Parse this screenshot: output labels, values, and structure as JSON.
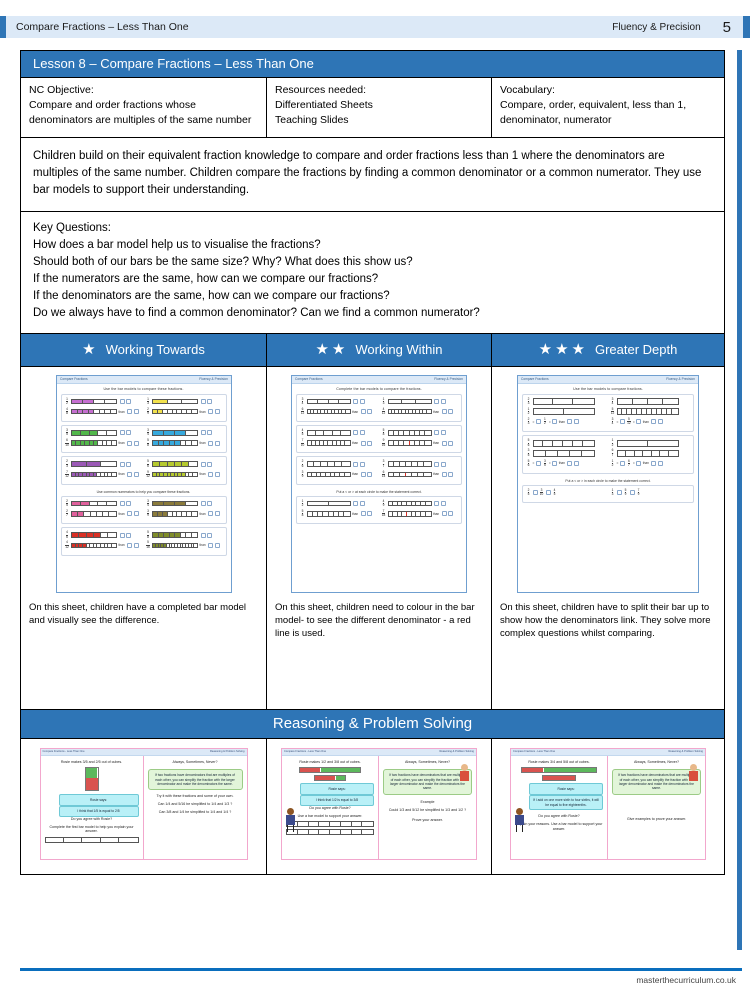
{
  "header": {
    "title": "Compare Fractions – Less Than One",
    "section": "Fluency & Precision",
    "page_number": "5",
    "accent_color": "#2E75B6",
    "background_color": "#DCE9F7"
  },
  "lesson": {
    "title": "Lesson 8 – Compare Fractions – Less Than One"
  },
  "info": {
    "objective_label": "NC Objective:",
    "objective_line1": "Compare and order fractions whose",
    "objective_line2": "denominators are multiples of the same number",
    "resources_label": "Resources needed:",
    "resources_line1": "Differentiated Sheets",
    "resources_line2": "Teaching Slides",
    "vocabulary_label": "Vocabulary:",
    "vocabulary_line1": "Compare, order, equivalent, less than 1,",
    "vocabulary_line2": "denominator, numerator"
  },
  "overview": {
    "text": "Children build on their equivalent fraction knowledge to compare and order fractions less than 1 where the denominators are multiples of the same number. Children compare the fractions by finding a common denominator or a common numerator. They use bar models to support their understanding."
  },
  "key_questions": {
    "label": "Key Questions:",
    "items": [
      "How does a bar model help us to visualise the fractions?",
      "Should both of our bars be the same size? Why? What does this show us?",
      "If the numerators are the same, how can we compare our fractions?",
      "If the denominators are the same, how can we compare our fractions?",
      "Do we always have to find a common denominator? Can we find a common numerator?"
    ]
  },
  "differentiation": {
    "columns": [
      {
        "label": "Working Towards",
        "stars": 1,
        "description": "On this sheet, children have a completed bar model and visually see the difference.",
        "sheet": {
          "header_left": "Compare Fractions",
          "header_right": "Fluency & Precision",
          "instruction": "Use the bar models to compare these fractions.",
          "sub_instruction": "Use common numerators to help you compare these fractions."
        }
      },
      {
        "label": "Working Within",
        "stars": 2,
        "description": "On this sheet, children need to colour in the bar model- to see the different denominator - a red line is used.",
        "sheet": {
          "header_left": "Compare Fractions",
          "header_right": "Fluency & Precision",
          "instruction": "Complete the bar models to compare the fractions.",
          "sub_instruction": "Put a < or > at each circle to make the statement correct."
        }
      },
      {
        "label": "Greater Depth",
        "stars": 3,
        "description": "On this sheet, children  have to split their bar up to show how the denominators link. They solve more complex questions whilst comparing.",
        "sheet": {
          "header_left": "Compare Fractions",
          "header_right": "Fluency & Precision",
          "instruction": "Use the bar models to compare fractions.",
          "sub_instruction": "Put a < or > in each circle to make the statement correct."
        }
      }
    ]
  },
  "reasoning": {
    "banner": "Reasoning & Problem Solving",
    "cards": [
      {
        "header_left": "Compare Fractions - Less Than One",
        "header_right": "Reasoning & Problem Solving",
        "left_prompt": "Rosie makes 3/5 and 2/5 out of cubes.",
        "speaker_label": "Rosie says:",
        "speech": "I think that 1/5 is equal to 2/5",
        "left_question": "Do you agree with Rosie?",
        "left_hint": "Complete the first bar model to help you explain your answer.",
        "right_title": "Always, Sometimes, Never?",
        "right_statement": "If two fractions have denominators that are multiples of each other, you can simplify the fraction with the larger denominator and make the denominators the same.",
        "right_try": "Try it with these fractions and some of your own.",
        "right_example1": "Can 1/4 and 5/16 be simplified to 1/4 and 1/3 ?",
        "right_example2": "Can 3/8 and 1/4 be simplified to 1/4 and 1/4 ?"
      },
      {
        "header_left": "Compare Fractions - Less Than One",
        "header_right": "Reasoning & Problem Solving",
        "left_prompt": "Rosie makes 1/2 and 3/8 out of cubes.",
        "speaker_label": "Rosie says:",
        "speech": "I think that 1/2 is equal to 3/8",
        "left_question": "Do you agree with Rosie?",
        "left_hint": "Use a bar model to support your answer.",
        "right_title": "Always, Sometimes, Never?",
        "right_statement": "If two fractions have denominators that are multiples of each other, you can simplify the fraction with the larger denominator and make the denominators the same.",
        "right_try": "Example",
        "right_example1": "Could 1/3 and 5/12 be simplified to 1/3 and 1/2 ?",
        "right_example2": "Prove your answer."
      },
      {
        "header_left": "Compare Fractions - Less Than One",
        "header_right": "Reasoning & Problem Solving",
        "left_prompt": "Rosie makes 3/4 and 5/8 out of cubes.",
        "speaker_label": "Rosie says:",
        "speech": "If I add on one more sixth to four sixths, it will be equal to five eighteenths.",
        "left_question": "Do you agree with Rosie?",
        "left_hint": "Explain your reasons. Use a bar model to support your answer.",
        "right_title": "Always, Sometimes, Never?",
        "right_statement": "If two fractions have denominators that are multiples of each other, you can simplify the fraction with the larger denominator and make the denominators the same.",
        "right_try": "Give examples to prove your answer.",
        "right_example1": "",
        "right_example2": ""
      }
    ]
  },
  "footer": {
    "url": "masterthecurriculum.co.uk",
    "rule_color": "#0A6EBD"
  }
}
